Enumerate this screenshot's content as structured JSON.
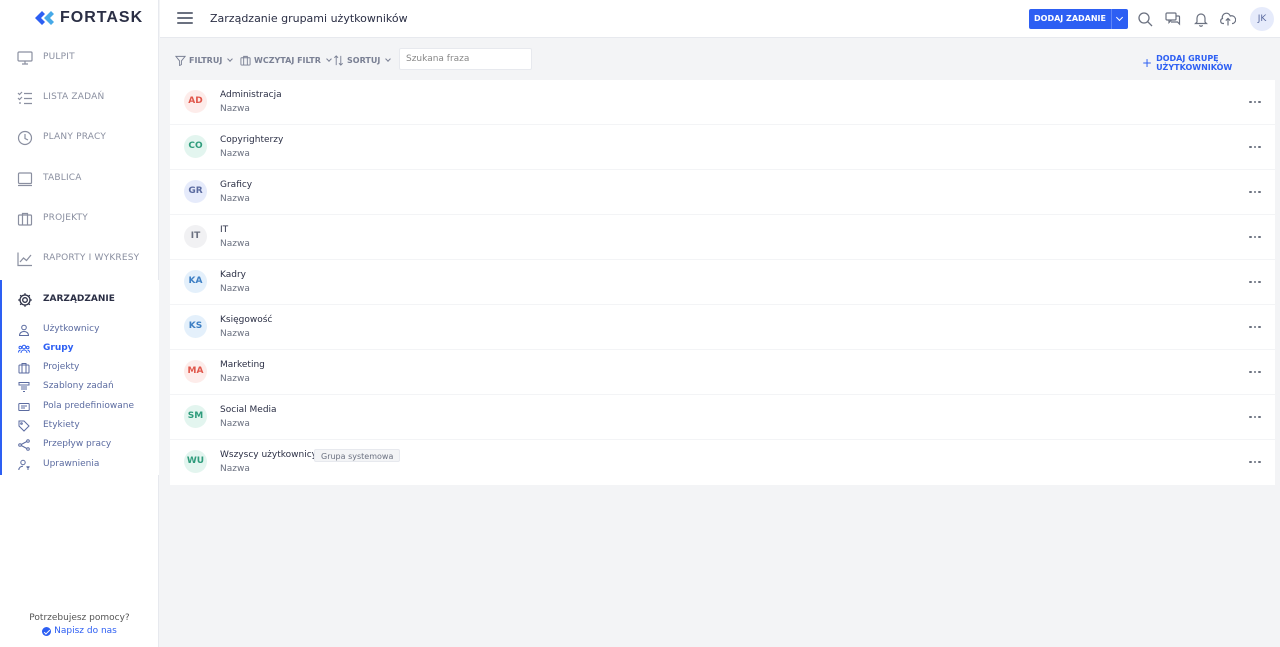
{
  "app": {
    "logo_text": "FORTASK"
  },
  "sidebar": {
    "nav": [
      {
        "label": "PULPIT",
        "icon": "monitor-icon"
      },
      {
        "label": "LISTA ZADAŃ",
        "icon": "checklist-icon"
      },
      {
        "label": "PLANY PRACY",
        "icon": "clock-icon"
      },
      {
        "label": "TABLICA",
        "icon": "board-icon"
      },
      {
        "label": "PROJEKTY",
        "icon": "briefcase-icon"
      },
      {
        "label": "RAPORTY I WYKRESY",
        "icon": "chart-line-icon"
      }
    ],
    "management": {
      "label": "ZARZĄDZANIE",
      "icon": "gear-icon",
      "items": [
        {
          "label": "Użytkownicy",
          "icon": "user-icon",
          "active": false
        },
        {
          "label": "Grupy",
          "icon": "users-icon",
          "active": true
        },
        {
          "label": "Projekty",
          "icon": "briefcase-icon",
          "active": false
        },
        {
          "label": "Szablony zadań",
          "icon": "template-icon",
          "active": false
        },
        {
          "label": "Pola predefiniowane",
          "icon": "field-icon",
          "active": false
        },
        {
          "label": "Etykiety",
          "icon": "tag-icon",
          "active": false
        },
        {
          "label": "Przepływ pracy",
          "icon": "workflow-icon",
          "active": false
        },
        {
          "label": "Uprawnienia",
          "icon": "permission-icon",
          "active": false
        }
      ]
    },
    "help": {
      "question": "Potrzebujesz pomocy?",
      "link": "Napisz do nas"
    }
  },
  "header": {
    "title": "Zarządzanie grupami użytkowników",
    "add_task_label": "DODAJ ZADANIE",
    "user_initials": "JK"
  },
  "toolbar": {
    "filter_label": "FILTRUJ",
    "load_filter_label": "WCZYTAJ FILTR",
    "sort_label": "SORTUJ",
    "search_placeholder": "Szukana fraza",
    "add_group_label": "DODAJ GRUPĘ UŻYTKOWNIKÓW"
  },
  "groups": [
    {
      "initials": "AD",
      "name": "Administracja",
      "sub": "Nazwa",
      "bg": "#fdecea",
      "fg": "#e0564a",
      "badge": ""
    },
    {
      "initials": "CO",
      "name": "Copyrighterzy",
      "sub": "Nazwa",
      "bg": "#e3f5ef",
      "fg": "#2f9c7c",
      "badge": ""
    },
    {
      "initials": "GR",
      "name": "Graficy",
      "sub": "Nazwa",
      "bg": "#e6ebfb",
      "fg": "#5b6ba0",
      "badge": ""
    },
    {
      "initials": "IT",
      "name": "IT",
      "sub": "Nazwa",
      "bg": "#f1f1f3",
      "fg": "#6b7180",
      "badge": ""
    },
    {
      "initials": "KA",
      "name": "Kadry",
      "sub": "Nazwa",
      "bg": "#e4f0fb",
      "fg": "#3d7fc4",
      "badge": ""
    },
    {
      "initials": "KS",
      "name": "Księgowość",
      "sub": "Nazwa",
      "bg": "#e4f0fb",
      "fg": "#3d7fc4",
      "badge": ""
    },
    {
      "initials": "MA",
      "name": "Marketing",
      "sub": "Nazwa",
      "bg": "#fdecea",
      "fg": "#e0564a",
      "badge": ""
    },
    {
      "initials": "SM",
      "name": "Social Media",
      "sub": "Nazwa",
      "bg": "#e3f5ef",
      "fg": "#2f9c7c",
      "badge": ""
    },
    {
      "initials": "WU",
      "name": "Wszyscy użytkownicy",
      "sub": "Nazwa",
      "bg": "#e3f5ef",
      "fg": "#2f9c7c",
      "badge": "Grupa systemowa"
    }
  ],
  "colors": {
    "accent": "#2d5ff3",
    "sidebar_text": "#8a8fa0",
    "row_bg": "#ffffff",
    "page_bg": "#f3f4f6"
  }
}
